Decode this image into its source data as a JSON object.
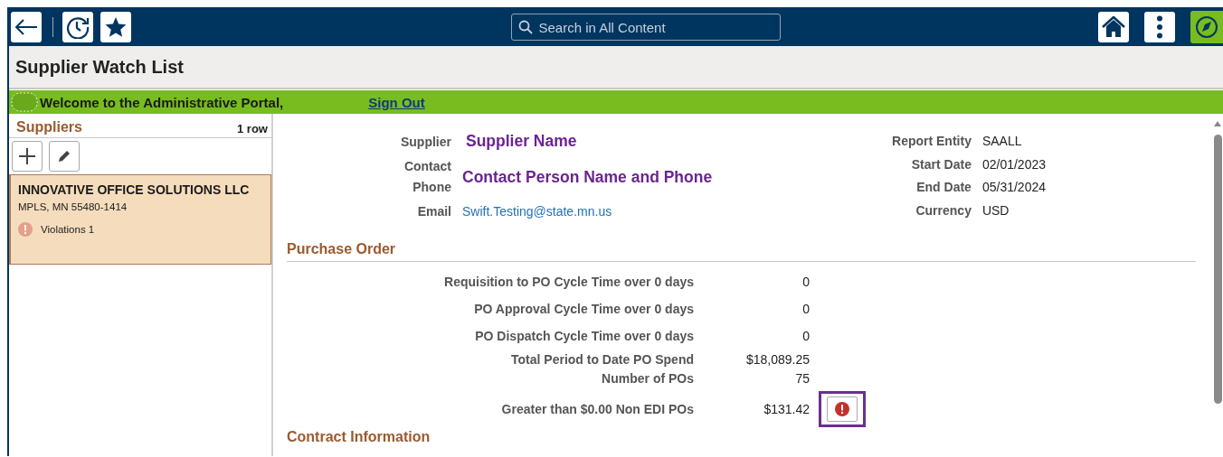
{
  "header": {
    "search": {
      "placeholder": "Search in All Content"
    }
  },
  "page_title": "Supplier Watch List",
  "welcome": {
    "text": "Welcome to the Administrative Portal,",
    "link": "Sign Out"
  },
  "suppliers": {
    "title": "Suppliers",
    "count": "1 row",
    "items": [
      {
        "name": "INNOVATIVE OFFICE SOLUTIONS LLC",
        "address": "MPLS, MN  55480-1414",
        "violations": "Violations 1",
        "selected": true
      }
    ]
  },
  "details": {
    "left": [
      {
        "label": "Supplier",
        "value": "Supplier Name",
        "kind": "name"
      },
      {
        "label": "Contact",
        "label2": "Phone",
        "value": "Contact Person Name and Phone",
        "kind": "contact"
      },
      {
        "label": "Email",
        "value": "Swift.Testing@state.mn.us",
        "kind": "email"
      }
    ],
    "right": [
      {
        "label": "Report Entity",
        "value": "SAALL"
      },
      {
        "label": "Start Date",
        "value": "02/01/2023"
      },
      {
        "label": "End Date",
        "value": "05/31/2024"
      },
      {
        "label": "Currency",
        "value": "USD"
      }
    ]
  },
  "purchase_order": {
    "title": "Purchase Order",
    "rows": [
      {
        "label": "Requisition to PO Cycle Time over 0 days",
        "value": "0",
        "flagged": false
      },
      {
        "label": "PO Approval Cycle Time over 0 days",
        "value": "0",
        "flagged": false
      },
      {
        "label": "PO Dispatch Cycle Time over 0 days",
        "value": "0",
        "flagged": false
      },
      {
        "label": "Total Period to Date PO Spend",
        "value": "$18,089.25",
        "flagged": false
      },
      {
        "label": "Number of POs",
        "value": "75",
        "flagged": false
      },
      {
        "label": "Greater than $0.00 Non EDI POs",
        "value": "$131.42",
        "flagged": true
      }
    ]
  },
  "contract": {
    "title": "Contract Information"
  }
}
